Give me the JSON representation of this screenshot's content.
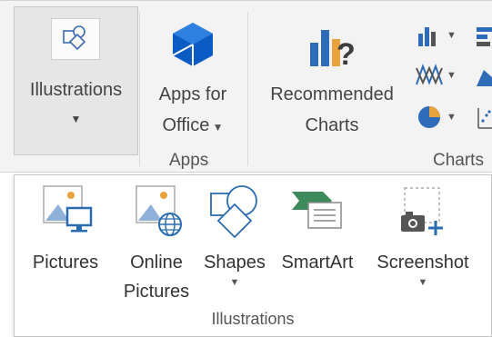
{
  "ribbon": {
    "illustrations": {
      "label": "Illustrations",
      "icon": "illustrations-icon"
    },
    "apps_for_office": {
      "line1": "Apps for",
      "line2": "Office",
      "icon": "apps-for-office-icon"
    },
    "recommended_charts": {
      "line1": "Recommended",
      "line2": "Charts",
      "icon": "recommended-charts-icon"
    },
    "group_labels": {
      "apps": "Apps",
      "charts": "Charts"
    }
  },
  "dropdown": {
    "items": [
      {
        "label": "Pictures"
      },
      {
        "line1": "Online",
        "line2": "Pictures"
      },
      {
        "label": "Shapes"
      },
      {
        "label": "SmartArt"
      },
      {
        "label": "Screenshot"
      }
    ],
    "group_label": "Illustrations"
  },
  "colors": {
    "accent_blue": "#2b6cb0",
    "office_blue": "#0a5bc4",
    "orange": "#e8a33d",
    "ribbon_bg": "#f3f3f3"
  }
}
